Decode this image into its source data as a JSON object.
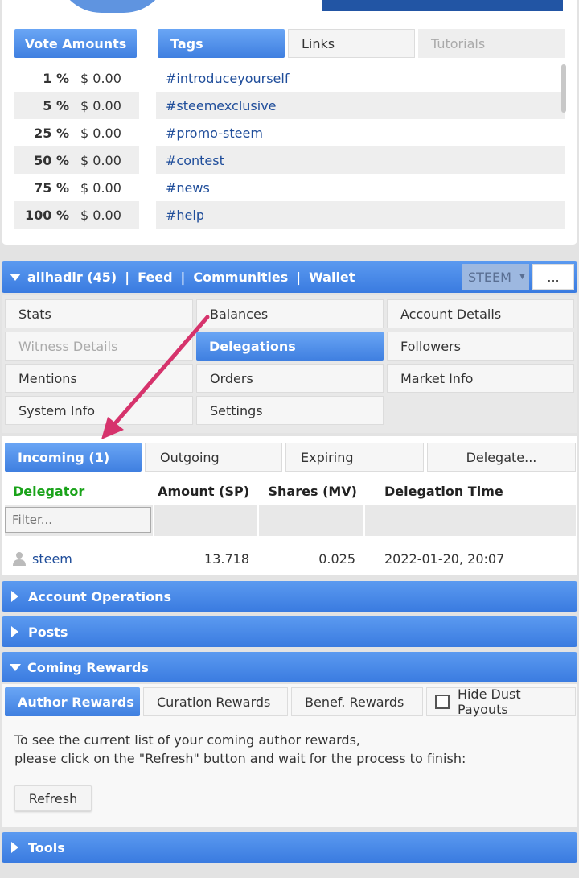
{
  "vote": {
    "header": "Vote Amounts",
    "rows": [
      {
        "pct": "1 %",
        "amt": "$ 0.00"
      },
      {
        "pct": "5 %",
        "amt": "$ 0.00"
      },
      {
        "pct": "25 %",
        "amt": "$ 0.00"
      },
      {
        "pct": "50 %",
        "amt": "$ 0.00"
      },
      {
        "pct": "75 %",
        "amt": "$ 0.00"
      },
      {
        "pct": "100 %",
        "amt": "$ 0.00"
      }
    ]
  },
  "tagtabs": {
    "tags": "Tags",
    "links": "Links",
    "tutorials": "Tutorials"
  },
  "tags": [
    "#introduceyourself",
    "#steemexclusive",
    "#promo-steem",
    "#contest",
    "#news",
    "#help"
  ],
  "nav": {
    "user": "alihadir (45)",
    "sep": "|",
    "feed": "Feed",
    "communities": "Communities",
    "wallet": "Wallet",
    "currency": "STEEM",
    "more": "..."
  },
  "menu": {
    "stats": "Stats",
    "balances": "Balances",
    "account_details": "Account Details",
    "witness_details": "Witness Details",
    "delegations": "Delegations",
    "followers": "Followers",
    "mentions": "Mentions",
    "orders": "Orders",
    "market_info": "Market Info",
    "system_info": "System Info",
    "settings": "Settings"
  },
  "deltabs": {
    "incoming": "Incoming (1)",
    "outgoing": "Outgoing",
    "expiring": "Expiring",
    "delegate": "Delegate..."
  },
  "table": {
    "headers": [
      "Delegator",
      "Amount (SP)",
      "Shares (MV)",
      "Delegation Time"
    ],
    "filter_placeholder": "Filter...",
    "rows": [
      {
        "delegator": "steem",
        "amount": "13.718",
        "shares": "0.025",
        "time": "2022-01-20, 20:07"
      }
    ]
  },
  "sections": {
    "account_ops": "Account Operations",
    "posts": "Posts",
    "coming_rewards": "Coming Rewards",
    "tools": "Tools"
  },
  "rewardtabs": {
    "author": "Author Rewards",
    "curation": "Curation Rewards",
    "benef": "Benef. Rewards",
    "hide_dust": "Hide Dust Payouts"
  },
  "rewards_msg": {
    "line1": "To see the current list of your coming author rewards,",
    "line2": "please click on the \"Refresh\" button and wait for the process to finish:",
    "refresh": "Refresh"
  },
  "colors": {
    "accent_blue": "#3f7fe0",
    "link_blue": "#1f4d9a",
    "delegator_green": "#1aa31a",
    "arrow_pink": "#d6336c"
  }
}
